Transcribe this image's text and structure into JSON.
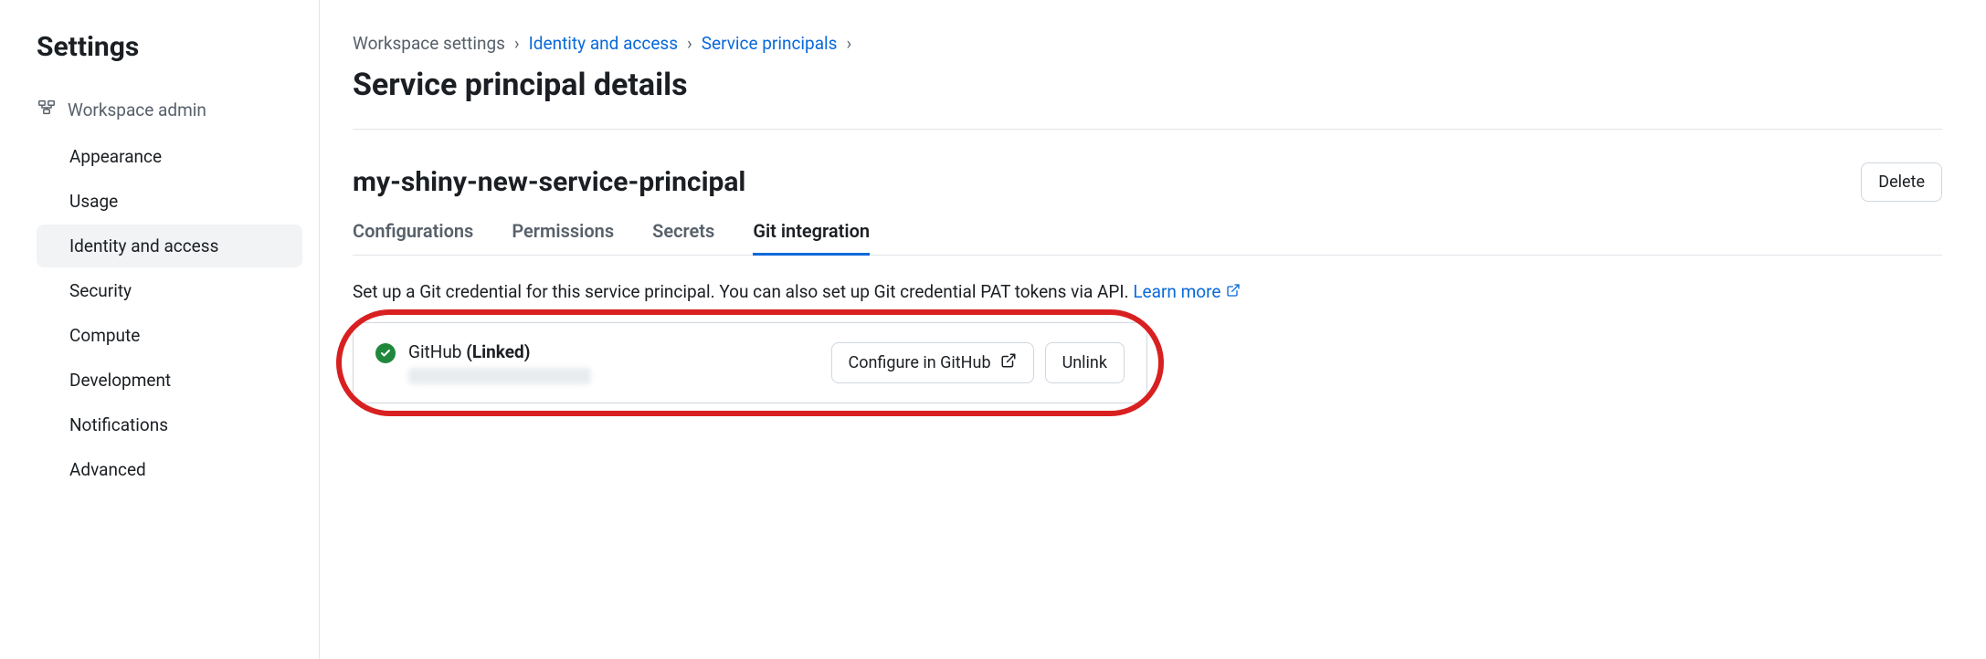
{
  "sidebar": {
    "title": "Settings",
    "section_label": "Workspace admin",
    "items": [
      {
        "label": "Appearance",
        "active": false
      },
      {
        "label": "Usage",
        "active": false
      },
      {
        "label": "Identity and access",
        "active": true
      },
      {
        "label": "Security",
        "active": false
      },
      {
        "label": "Compute",
        "active": false
      },
      {
        "label": "Development",
        "active": false
      },
      {
        "label": "Notifications",
        "active": false
      },
      {
        "label": "Advanced",
        "active": false
      }
    ]
  },
  "breadcrumb": {
    "items": [
      {
        "label": "Workspace settings",
        "link": false
      },
      {
        "label": "Identity and access",
        "link": true
      },
      {
        "label": "Service principals",
        "link": true
      }
    ]
  },
  "page": {
    "heading": "Service principal details",
    "entity_name": "my-shiny-new-service-principal",
    "delete_label": "Delete"
  },
  "tabs": [
    {
      "label": "Configurations",
      "active": false
    },
    {
      "label": "Permissions",
      "active": false
    },
    {
      "label": "Secrets",
      "active": false
    },
    {
      "label": "Git integration",
      "active": true
    }
  ],
  "description": {
    "text": "Set up a Git credential for this service principal. You can also set up Git credential PAT tokens via API. ",
    "learn_more_label": "Learn more"
  },
  "git_card": {
    "provider": "GitHub ",
    "status": "(Linked)",
    "configure_label": "Configure in GitHub",
    "unlink_label": "Unlink"
  }
}
